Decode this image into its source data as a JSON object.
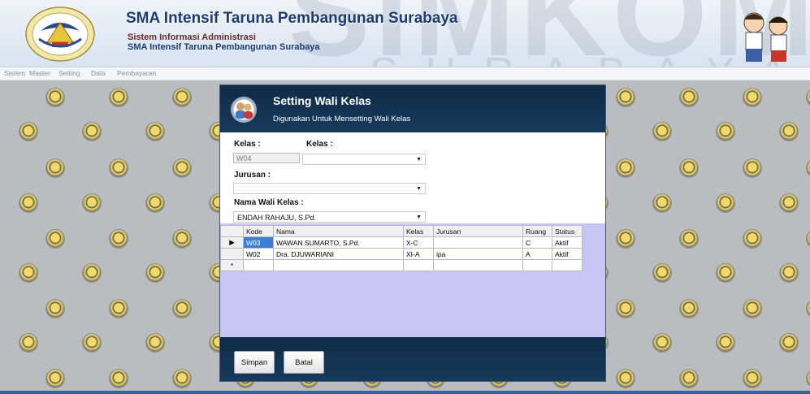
{
  "header": {
    "title": "SMA Intensif Taruna Pembangunan Surabaya",
    "subtitle1": "Sistem Informasi Administrasi",
    "subtitle2": "SMA Intensif Taruna Pembangunan Surabaya",
    "watermark_top": "SIMKOM",
    "watermark_bottom": "SURABAYA"
  },
  "menu": [
    "Sistem",
    "Master",
    "Setting",
    "Data",
    "Pembayaran"
  ],
  "dialog": {
    "title": "Setting Wali Kelas",
    "description": "Digunakan Untuk Mensetting Wali Kelas",
    "kelas_label_1": "Kelas  :",
    "kelas_label_2": "Kelas  :",
    "kelas_code_value": "W04",
    "kelas_combo_value": "",
    "jurusan_label": "Jurusan  :",
    "jurusan_value": "",
    "wali_label": "Nama Wali Kelas  :",
    "wali_value": "ENDAH RAHAJU, S.Pd.",
    "save_label": "Simpan",
    "cancel_label": "Batal"
  },
  "grid": {
    "columns": [
      "Kode",
      "Nama",
      "Kelas",
      "Jurusan",
      "Ruang",
      "Status"
    ],
    "rows": [
      {
        "marker": "▶",
        "kode": "W03",
        "nama": "WAWAN SUMARTO, S.Pd.",
        "kelas": "X-C",
        "jurusan": "",
        "ruang": "C",
        "status": "Aktif"
      },
      {
        "marker": "",
        "kode": "W02",
        "nama": "Dra. DJUWARIANI",
        "kelas": "XI-A",
        "jurusan": "ipa",
        "ruang": "A",
        "status": "Aktif"
      },
      {
        "marker": "*",
        "kode": "",
        "nama": "",
        "kelas": "",
        "jurusan": "",
        "ruang": "",
        "status": ""
      }
    ]
  },
  "colors": {
    "dialog_header": "#0f2b47",
    "grid_background": "#c6c5f4",
    "selected_cell": "#3b80d6",
    "title_text": "#1b3b73"
  }
}
